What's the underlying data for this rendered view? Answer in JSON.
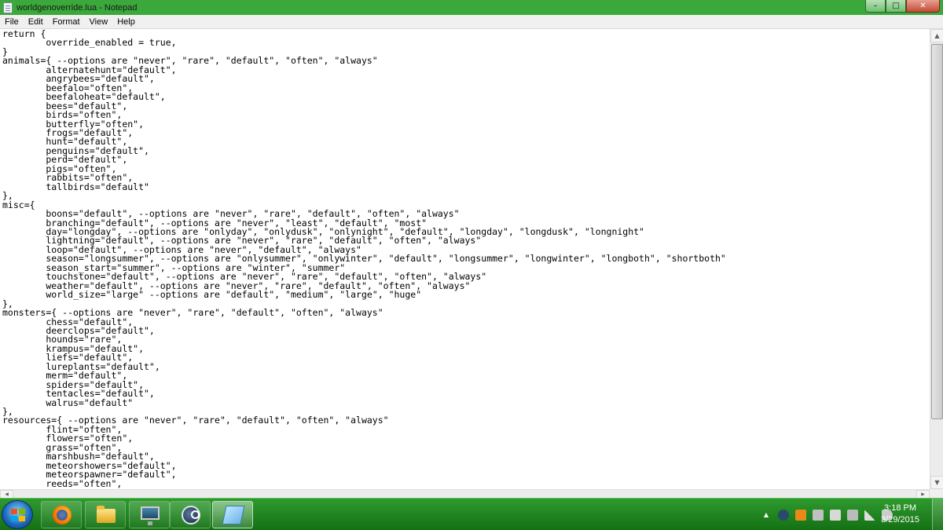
{
  "window": {
    "title": "worldgenoverride.lua - Notepad",
    "minimize_glyph": "–",
    "maximize_glyph": "□",
    "close_glyph": "✕"
  },
  "menu": {
    "file": "File",
    "edit": "Edit",
    "format": "Format",
    "view": "View",
    "help": "Help"
  },
  "document": {
    "content": "return {\n        override_enabled = true,\n}\nanimals={ --options are \"never\", \"rare\", \"default\", \"often\", \"always\"\n        alternatehunt=\"default\",\n        angrybees=\"default\",\n        beefalo=\"often\",\n        beefaloheat=\"default\",\n        bees=\"default\",\n        birds=\"often\",\n        butterfly=\"often\",\n        frogs=\"default\",\n        hunt=\"default\",\n        penguins=\"default\",\n        perd=\"default\",\n        pigs=\"often\",\n        rabbits=\"often\",\n        tallbirds=\"default\"\n},\nmisc={\n        boons=\"default\", --options are \"never\", \"rare\", \"default\", \"often\", \"always\"\n        branching=\"default\", --options are \"never\", \"least\", \"default\", \"most\"\n        day=\"longday\", --options are \"onlyday\", \"onlydusk\", \"onlynight\", \"default\", \"longday\", \"longdusk\", \"longnight\"\n        lightning=\"default\", --options are \"never\", \"rare\", \"default\", \"often\", \"always\"\n        loop=\"default\", --options are \"never\", \"default\", \"always\"\n        season=\"longsummer\", --options are \"onlysummer\", \"onlywinter\", \"default\", \"longsummer\", \"longwinter\", \"longboth\", \"shortboth\"\n        season_start=\"summer\", --options are \"winter\", \"summer\"\n        touchstone=\"default\", --options are \"never\", \"rare\", \"default\", \"often\", \"always\"\n        weather=\"default\", --options are \"never\", \"rare\", \"default\", \"often\", \"always\"\n        world_size=\"large\" --options are \"default\", \"medium\", \"large\", \"huge\"\n},\nmonsters={ --options are \"never\", \"rare\", \"default\", \"often\", \"always\"\n        chess=\"default\",\n        deerclops=\"default\",\n        hounds=\"rare\",\n        krampus=\"default\",\n        liefs=\"default\",\n        lureplants=\"default\",\n        merm=\"default\",\n        spiders=\"default\",\n        tentacles=\"default\",\n        walrus=\"default\"\n},\nresources={ --options are \"never\", \"rare\", \"default\", \"often\", \"always\"\n        flint=\"often\",\n        flowers=\"often\",\n        grass=\"often\",\n        marshbush=\"default\",\n        meteorshowers=\"default\",\n        meteorspawner=\"default\",\n        reeds=\"often\","
  },
  "scrollbar": {
    "up_glyph": "▲",
    "down_glyph": "▼",
    "left_glyph": "◀",
    "right_glyph": "▶"
  },
  "taskbar": {
    "apps": [
      {
        "name": "firefox-icon"
      },
      {
        "name": "folder-icon"
      },
      {
        "name": "monitor-icon"
      },
      {
        "name": "steam-icon"
      },
      {
        "name": "notepad-icon"
      }
    ],
    "tray": {
      "chevron": "▲",
      "time": "3:18 PM",
      "date": "3/29/2015"
    }
  },
  "colors": {
    "accent": "#3aa83a",
    "taskbar": "#1d7a1d",
    "close_button": "#c24a34"
  }
}
